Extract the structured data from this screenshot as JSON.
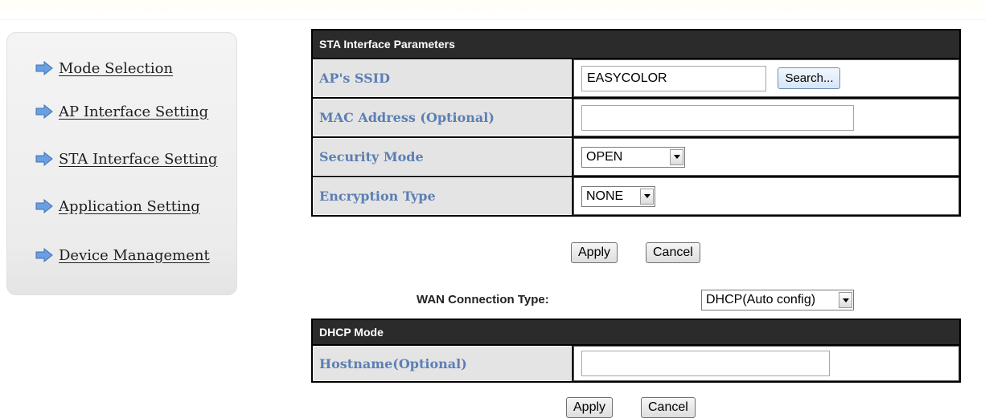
{
  "sidebar": {
    "items": [
      {
        "label": "Mode Selection"
      },
      {
        "label": "AP Interface Setting"
      },
      {
        "label": "STA Interface Setting"
      },
      {
        "label": "Application Setting"
      },
      {
        "label": "Device Management"
      }
    ],
    "arrow_icon": "arrow-right-icon",
    "arrow_color": "#6a9fe0"
  },
  "sta": {
    "header": "STA Interface Parameters",
    "ssid_label": "AP's SSID",
    "ssid_value": "EASYCOLOR",
    "search_label": "Search...",
    "mac_label": "MAC Address (Optional)",
    "mac_value": "",
    "security_label": "Security Mode",
    "security_value": "OPEN",
    "encryption_label": "Encryption Type",
    "encryption_value": "NONE",
    "apply_label": "Apply",
    "cancel_label": "Cancel"
  },
  "wan": {
    "label": "WAN Connection Type:",
    "value": "DHCP(Auto config)"
  },
  "dhcp": {
    "header": "DHCP Mode",
    "hostname_label": "Hostname(Optional)",
    "hostname_value": "",
    "apply_label": "Apply",
    "cancel_label": "Cancel"
  },
  "colors": {
    "header_bg": "#2b2b2b",
    "label_text": "#5b7fb4",
    "label_bg": "#e4e4e4"
  }
}
